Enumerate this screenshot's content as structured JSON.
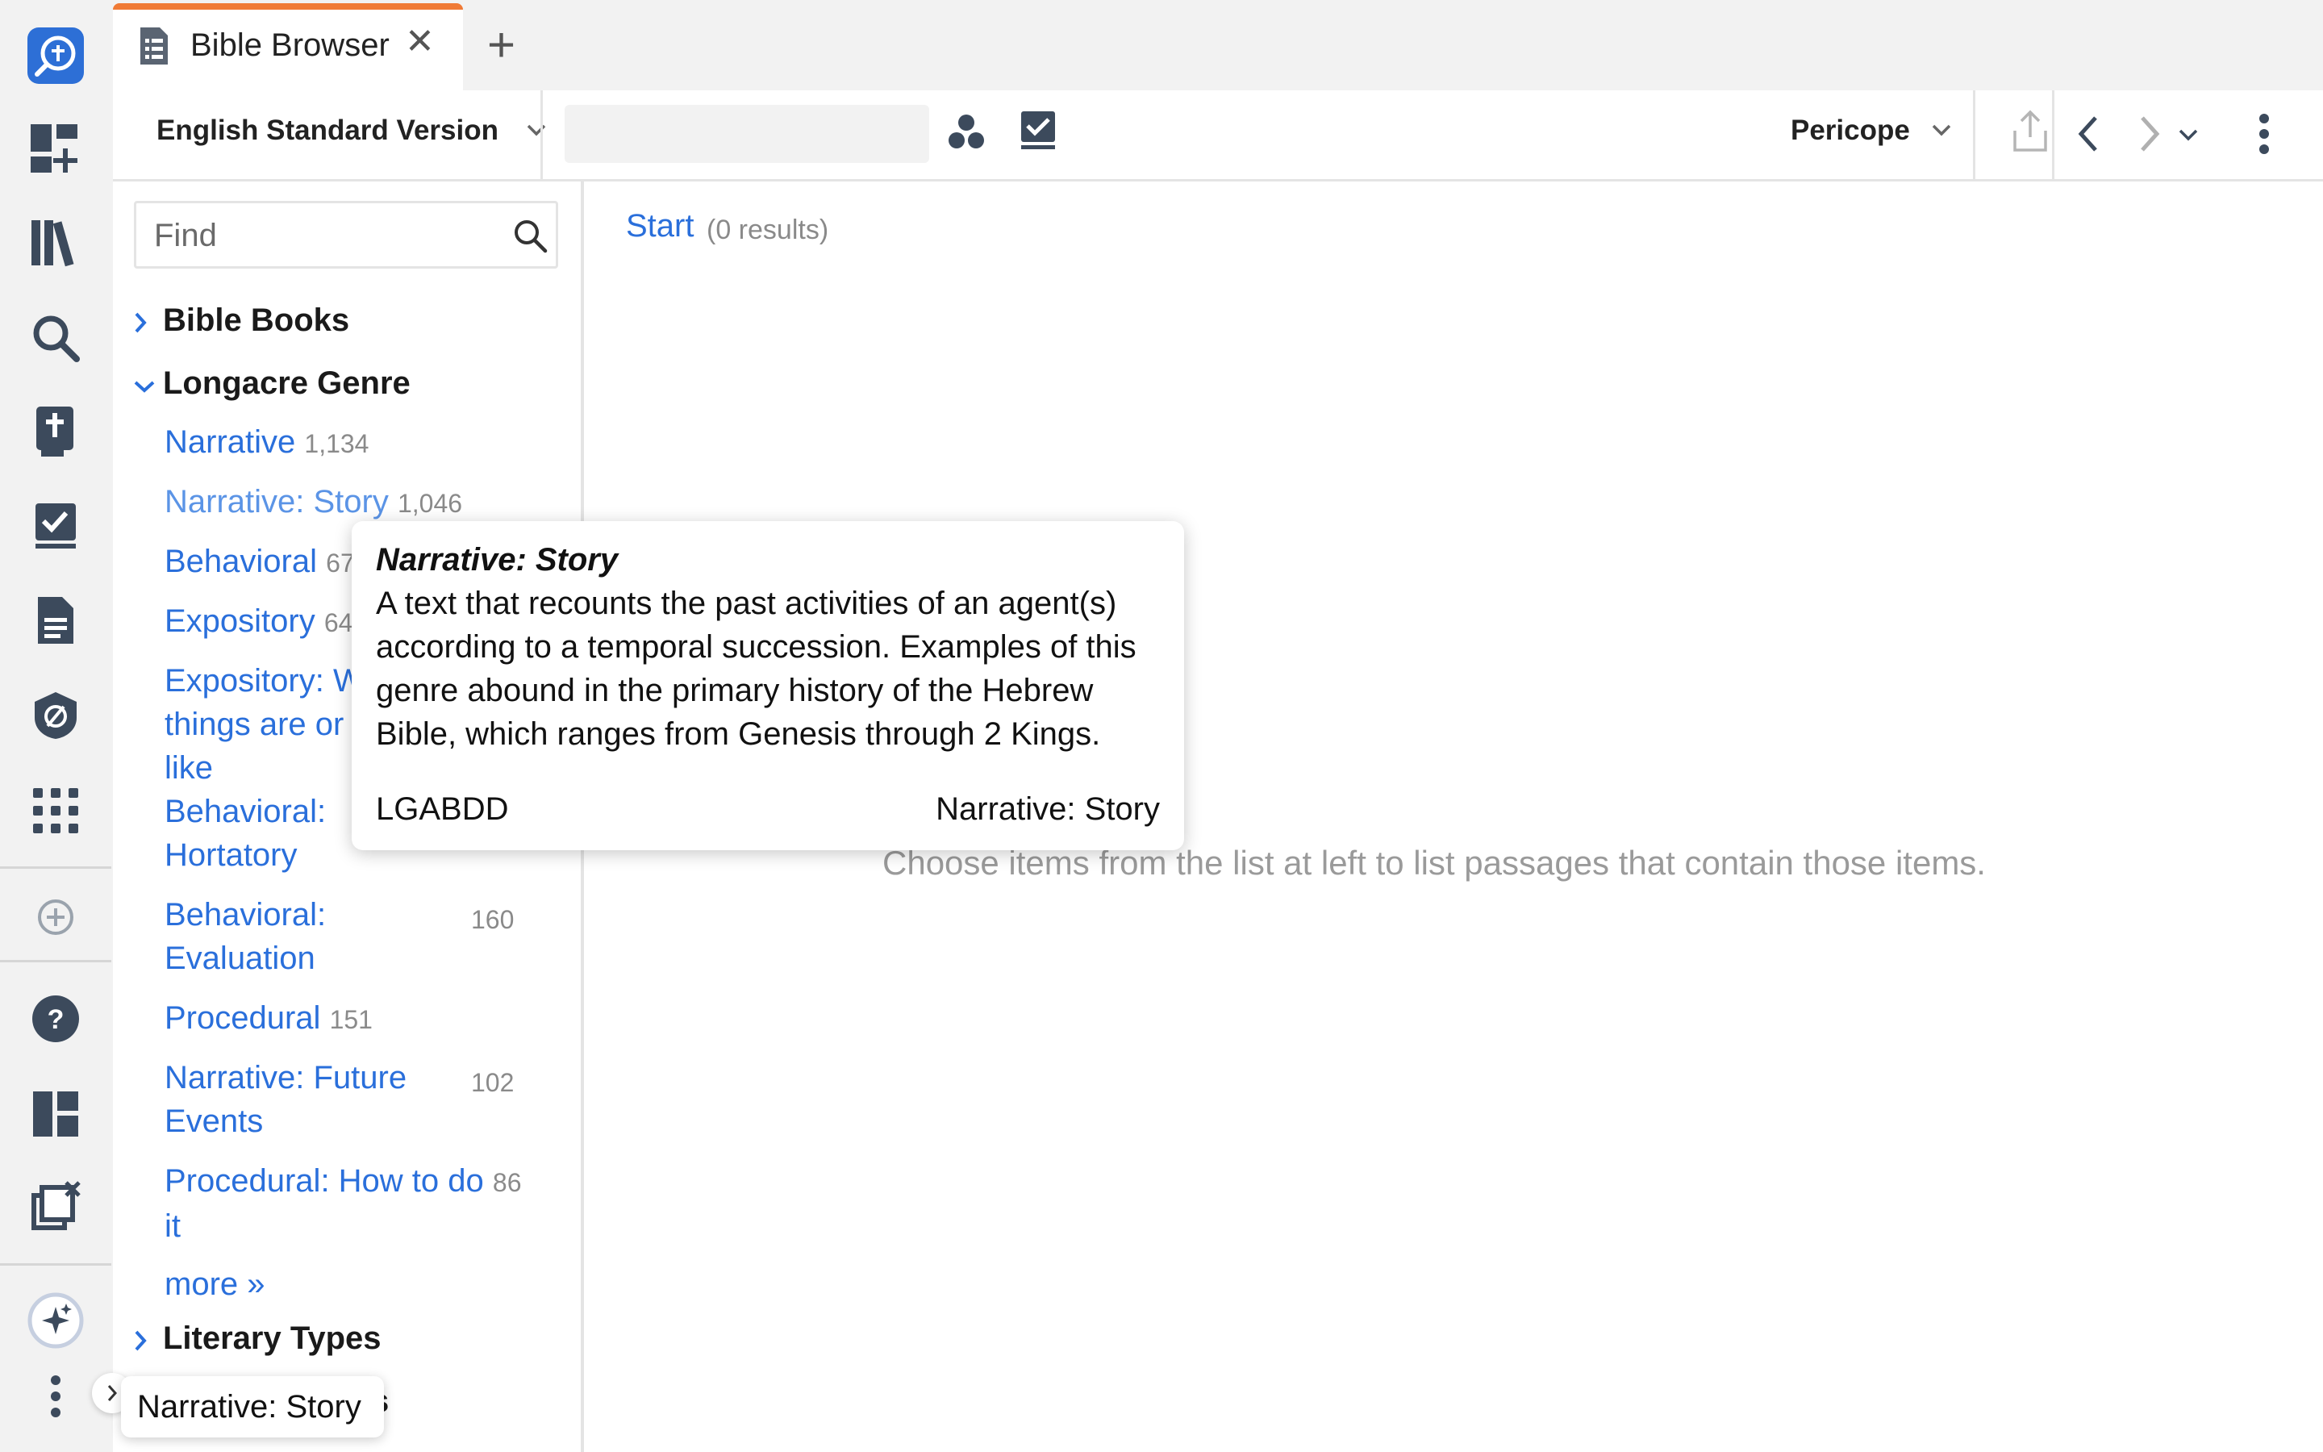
{
  "tab": {
    "title": "Bible Browser",
    "close_glyph": "✕",
    "add_glyph": "+"
  },
  "toolbar": {
    "version_label": "English Standard Version",
    "reference_placeholder": "",
    "view_label": "Pericope"
  },
  "sidebar": {
    "find_placeholder": "Find",
    "sections": [
      {
        "label": "Bible Books",
        "expanded": false
      },
      {
        "label": "Longacre Genre",
        "expanded": true
      },
      {
        "label": "Literary Types",
        "expanded": false
      }
    ],
    "genre_items": [
      {
        "label": "Narrative",
        "count": "1,134"
      },
      {
        "label": "Narrative: Story",
        "count": "1,046"
      },
      {
        "label": "Behavioral",
        "count": "67"
      },
      {
        "label": "Expository",
        "count": "64"
      },
      {
        "label_lines": [
          "Expository: W",
          "things are or",
          "like"
        ],
        "count": ""
      },
      {
        "label_lines": [
          "Behavioral:",
          "Hortatory"
        ],
        "count": ""
      },
      {
        "label_lines": [
          "Behavioral:",
          "Evaluation"
        ],
        "count": "160"
      },
      {
        "label": "Procedural",
        "count": "151"
      },
      {
        "label_lines": [
          "Narrative: Future",
          "Events"
        ],
        "count": "102"
      },
      {
        "label_lines": [
          "Procedural: How to do",
          "it"
        ],
        "count": "86"
      }
    ],
    "more_label": "more »",
    "last_partial": "s"
  },
  "results": {
    "start_label": "Start",
    "count_label": "(0 results)",
    "empty_message": "Choose items from the list at left to list passages that contain those items."
  },
  "tooltip": {
    "title": "Narrative: Story",
    "body": "A text that recounts the past activities of an agent(s) according to a temporal succession. Examples of this genre abound in the primary history of the Hebrew Bible, which ranges from Genesis through 2 Kings.",
    "code": "LGABDD",
    "name": "Narrative: Story"
  },
  "mini_tooltip": {
    "text": "Narrative: Story"
  },
  "colors": {
    "accent": "#2a6fdb",
    "tab_accent": "#f07a35",
    "rail_icon": "#3c4a5c",
    "logo": "#2d6fd6"
  },
  "rail_icons": [
    "logos-logo-icon",
    "add-dashboard-icon",
    "library-icon",
    "search-icon",
    "bible-icon",
    "checklist-icon",
    "document-icon",
    "shield-icon",
    "apps-grid-icon",
    "add-circle-icon",
    "help-icon",
    "layout-icon",
    "close-windows-icon",
    "ai-sparkle-icon",
    "more-vertical-icon"
  ]
}
